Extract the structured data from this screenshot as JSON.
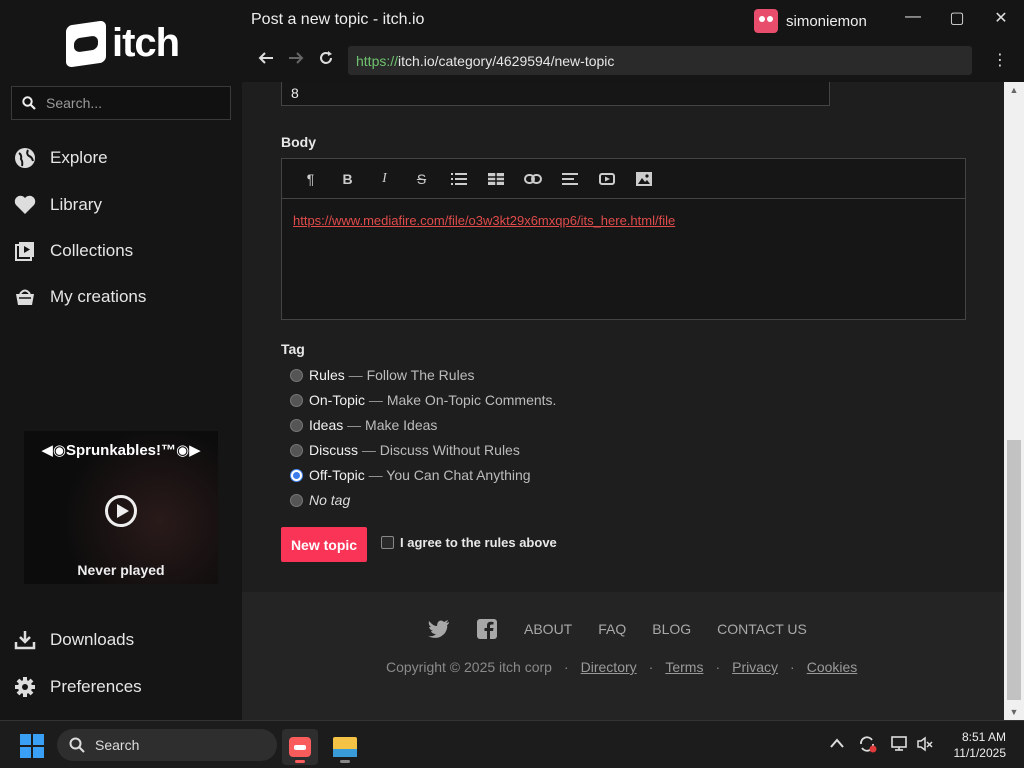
{
  "sidebar": {
    "logo_text": "itch",
    "search_placeholder": "Search...",
    "nav": [
      {
        "label": "Explore",
        "icon": "globe-icon"
      },
      {
        "label": "Library",
        "icon": "heart-icon"
      },
      {
        "label": "Collections",
        "icon": "collections-icon"
      },
      {
        "label": "My creations",
        "icon": "basket-icon"
      }
    ],
    "game": {
      "title": "◀◉Sprunkables!™◉▶",
      "status": "Never played"
    },
    "bottom_nav": [
      {
        "label": "Downloads",
        "icon": "download-icon"
      },
      {
        "label": "Preferences",
        "icon": "gear-icon"
      }
    ]
  },
  "window": {
    "title": "Post a new topic - itch.io",
    "user": "simoniemon",
    "controls": {
      "minimize": "—",
      "maximize": "▢",
      "close": "✕"
    }
  },
  "address": {
    "scheme": "https://",
    "rest": "itch.io/category/4629594/new-topic"
  },
  "form": {
    "number_value": "8",
    "body_label": "Body",
    "body_link": "https://www.mediafire.com/file/o3w3kt29x6mxqp6/its_here.html/file",
    "tag_label": "Tag",
    "tags": [
      {
        "name": "Rules",
        "sep": " — ",
        "desc": "Follow The Rules",
        "checked": false
      },
      {
        "name": "On-Topic",
        "sep": " — ",
        "desc": "Make On-Topic Comments.",
        "checked": false
      },
      {
        "name": "Ideas",
        "sep": " — ",
        "desc": "Make Ideas",
        "checked": false
      },
      {
        "name": "Discuss",
        "sep": " — ",
        "desc": "Discuss Without Rules",
        "checked": false
      },
      {
        "name": "Off-Topic",
        "sep": " — ",
        "desc": "You Can Chat Anything",
        "checked": true
      }
    ],
    "no_tag": "No tag",
    "submit_label": "New topic",
    "agree_label": "I agree to the rules above"
  },
  "footer": {
    "links": [
      "ABOUT",
      "FAQ",
      "BLOG",
      "CONTACT US"
    ],
    "copyright": "Copyright © 2025 itch corp",
    "legal": [
      "Directory",
      "Terms",
      "Privacy",
      "Cookies"
    ],
    "separator": "·"
  },
  "taskbar": {
    "search_label": "Search",
    "time": "8:51 AM",
    "date": "11/1/2025"
  }
}
